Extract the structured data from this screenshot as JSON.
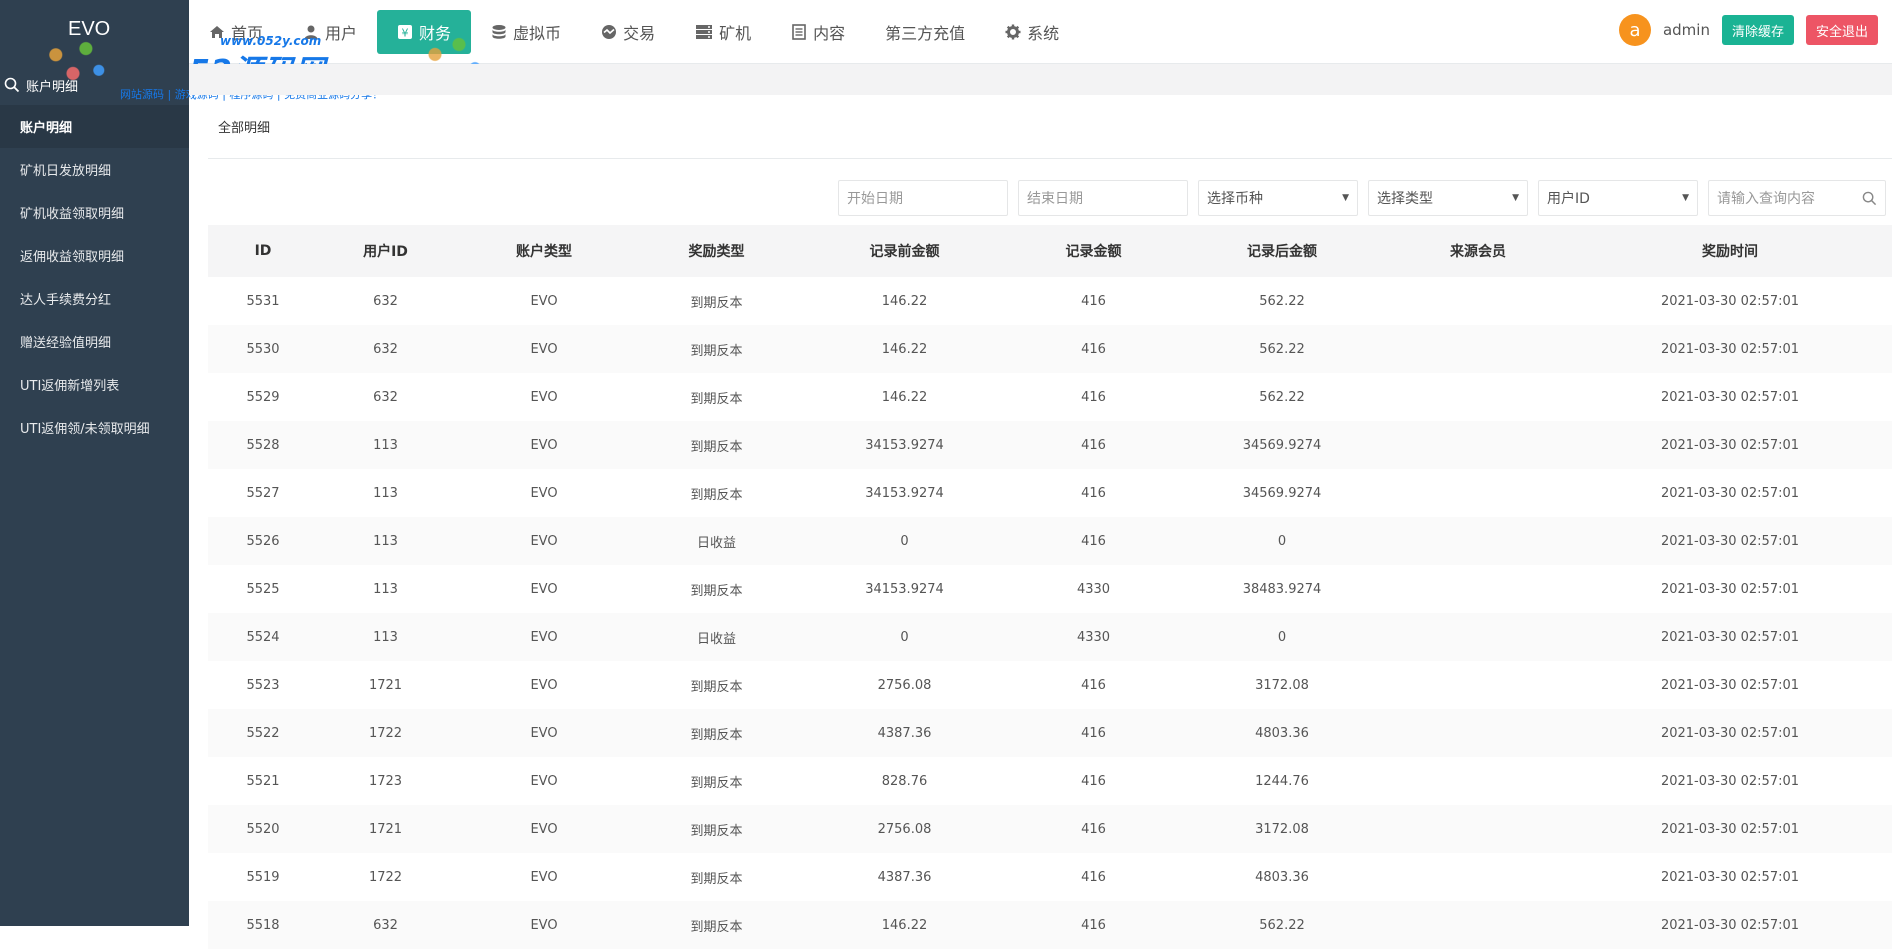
{
  "brand": {
    "name": "EVO"
  },
  "sidebar": {
    "search_label": "账户明细",
    "items": [
      {
        "label": "账户明细"
      },
      {
        "label": "矿机日发放明细"
      },
      {
        "label": "矿机收益领取明细"
      },
      {
        "label": "返佣收益领取明细"
      },
      {
        "label": "达人手续费分红"
      },
      {
        "label": "赠送经验值明细"
      },
      {
        "label": "UTI返佣新增列表"
      },
      {
        "label": "UTI返佣领/未领取明细"
      }
    ]
  },
  "nav": {
    "items": [
      {
        "label": "首页",
        "icon": "home-icon"
      },
      {
        "label": "用户",
        "icon": "user-icon"
      },
      {
        "label": "财务",
        "icon": "finance-icon"
      },
      {
        "label": "虚拟币",
        "icon": "database-icon"
      },
      {
        "label": "交易",
        "icon": "exchange-icon"
      },
      {
        "label": "矿机",
        "icon": "server-icon"
      },
      {
        "label": "内容",
        "icon": "document-icon"
      },
      {
        "label": "第三方充值",
        "icon": ""
      },
      {
        "label": "系统",
        "icon": "gear-icon"
      }
    ],
    "active_index": 2
  },
  "header": {
    "avatar_letter": "a",
    "username": "admin",
    "clear_cache": "清除缓存",
    "logout": "安全退出"
  },
  "watermark": {
    "url": "www.052y.com",
    "title": "52源码网",
    "subtitle": "网站源码 | 游戏源码 | 程序源码 | 免费商业源码分享！"
  },
  "tab": {
    "label": "全部明细"
  },
  "filters": {
    "start_date": "开始日期",
    "end_date": "结束日期",
    "coin": "选择币种",
    "type": "选择类型",
    "field": "用户ID",
    "query": "请输入查询内容"
  },
  "table": {
    "headers": [
      "ID",
      "用户ID",
      "账户类型",
      "奖励类型",
      "记录前金额",
      "记录金额",
      "记录后金额",
      "来源会员",
      "奖励时间"
    ],
    "rows": [
      [
        "5531",
        "632",
        "EVO",
        "到期反本",
        "146.22",
        "416",
        "562.22",
        "",
        "2021-03-30 02:57:01"
      ],
      [
        "5530",
        "632",
        "EVO",
        "到期反本",
        "146.22",
        "416",
        "562.22",
        "",
        "2021-03-30 02:57:01"
      ],
      [
        "5529",
        "632",
        "EVO",
        "到期反本",
        "146.22",
        "416",
        "562.22",
        "",
        "2021-03-30 02:57:01"
      ],
      [
        "5528",
        "113",
        "EVO",
        "到期反本",
        "34153.9274",
        "416",
        "34569.9274",
        "",
        "2021-03-30 02:57:01"
      ],
      [
        "5527",
        "113",
        "EVO",
        "到期反本",
        "34153.9274",
        "416",
        "34569.9274",
        "",
        "2021-03-30 02:57:01"
      ],
      [
        "5526",
        "113",
        "EVO",
        "日收益",
        "0",
        "416",
        "0",
        "",
        "2021-03-30 02:57:01"
      ],
      [
        "5525",
        "113",
        "EVO",
        "到期反本",
        "34153.9274",
        "4330",
        "38483.9274",
        "",
        "2021-03-30 02:57:01"
      ],
      [
        "5524",
        "113",
        "EVO",
        "日收益",
        "0",
        "4330",
        "0",
        "",
        "2021-03-30 02:57:01"
      ],
      [
        "5523",
        "1721",
        "EVO",
        "到期反本",
        "2756.08",
        "416",
        "3172.08",
        "",
        "2021-03-30 02:57:01"
      ],
      [
        "5522",
        "1722",
        "EVO",
        "到期反本",
        "4387.36",
        "416",
        "4803.36",
        "",
        "2021-03-30 02:57:01"
      ],
      [
        "5521",
        "1723",
        "EVO",
        "到期反本",
        "828.76",
        "416",
        "1244.76",
        "",
        "2021-03-30 02:57:01"
      ],
      [
        "5520",
        "1721",
        "EVO",
        "到期反本",
        "2756.08",
        "416",
        "3172.08",
        "",
        "2021-03-30 02:57:01"
      ],
      [
        "5519",
        "1722",
        "EVO",
        "到期反本",
        "4387.36",
        "416",
        "4803.36",
        "",
        "2021-03-30 02:57:01"
      ],
      [
        "5518",
        "632",
        "EVO",
        "到期反本",
        "146.22",
        "416",
        "562.22",
        "",
        "2021-03-30 02:57:01"
      ]
    ]
  }
}
